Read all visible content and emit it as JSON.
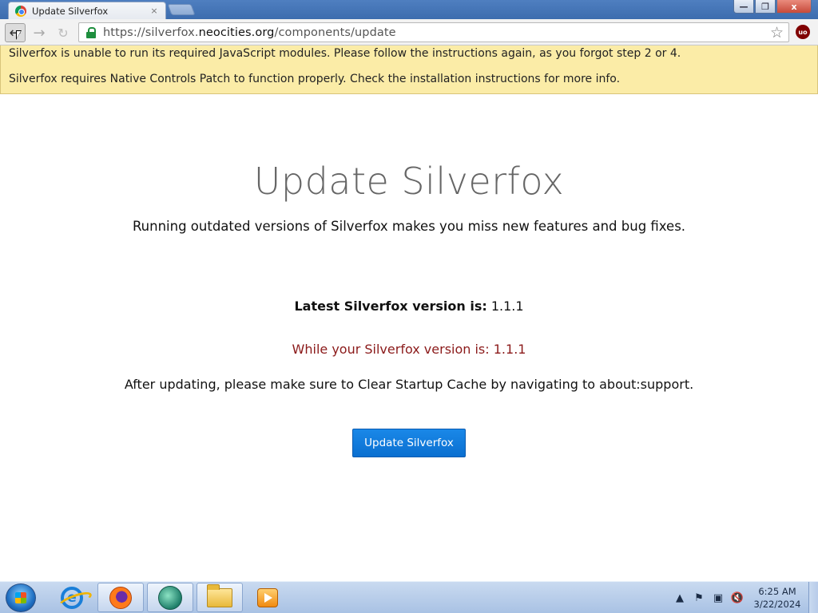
{
  "browser": {
    "tab_title": "Update Silverfox",
    "tab_close": "×",
    "url_scheme": "https://silverfox.",
    "url_domain": "neocities.org",
    "url_path": "/components/update",
    "ext_badge": "uo",
    "window_controls": {
      "minimize": "—",
      "maximize": "❐",
      "close": "x"
    }
  },
  "warnings": [
    "Silverfox is unable to run its required JavaScript modules. Please follow the instructions again, as you forgot step 2 or 4.",
    "Silverfox requires Native Controls Patch to function properly. Check the installation instructions for more info."
  ],
  "main": {
    "title": "Update Silverfox",
    "subtitle": "Running outdated versions of Silverfox makes you miss new features and bug fixes.",
    "latest_label": "Latest Silverfox version is:",
    "latest_version": "1.1.1",
    "yours_text": "While your Silverfox version is: 1.1.1",
    "after_text": "After updating, please make sure to Clear Startup Cache by navigating to about:support.",
    "update_button": "Update Silverfox"
  },
  "taskbar": {
    "time": "6:25 AM",
    "date": "3/22/2024",
    "apps": [
      "internet-explorer-icon",
      "firefox-icon",
      "globe-app-icon",
      "file-explorer-icon",
      "media-player-icon"
    ]
  },
  "colors": {
    "warning_bg": "#fbeca7",
    "button_blue": "#0a6fd0",
    "version_red": "#8b1a1a"
  }
}
